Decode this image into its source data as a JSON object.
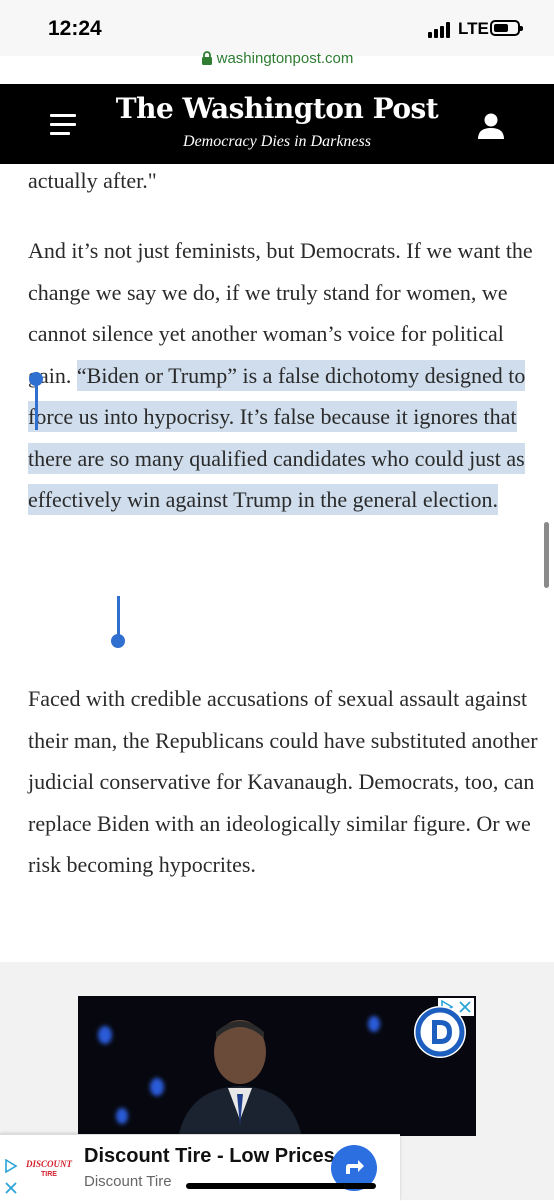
{
  "status": {
    "time": "12:24",
    "carrier": "LTE"
  },
  "browser": {
    "url": "washingtonpost.com"
  },
  "header": {
    "masthead": "The Washington Post",
    "tagline": "Democracy Dies in Darkness"
  },
  "article": {
    "p0": "actually after.\"",
    "p1_plain": "And it’s not just feminists, but Democrats. If we want the change we say we do, if we truly stand for women, we cannot silence yet another woman’s voice for political gain.",
    "p1_selected": "“Biden or Trump” is a false dichotomy designed to force us into hypocrisy. It’s false because it ignores that there are so many qualified candidates who could just as effectively win against Trump in the general election.",
    "p2": "Faced with credible accusations of sexual assault against their man, the Republicans could have substituted another judicial conservative for Kavanaugh. Democrats, too, can replace Biden with an ideologically similar figure. Or we risk becoming hypocrites."
  },
  "ads": {
    "bottom_title": "Discount Tire - Low Prices",
    "bottom_sub": "Discount Tire",
    "bottom_logo_text": "DISCOUNT TIRE"
  },
  "colors": {
    "selection": "#cfddec",
    "handle": "#2f6fd0",
    "brand_blue": "#2b6fe0"
  }
}
